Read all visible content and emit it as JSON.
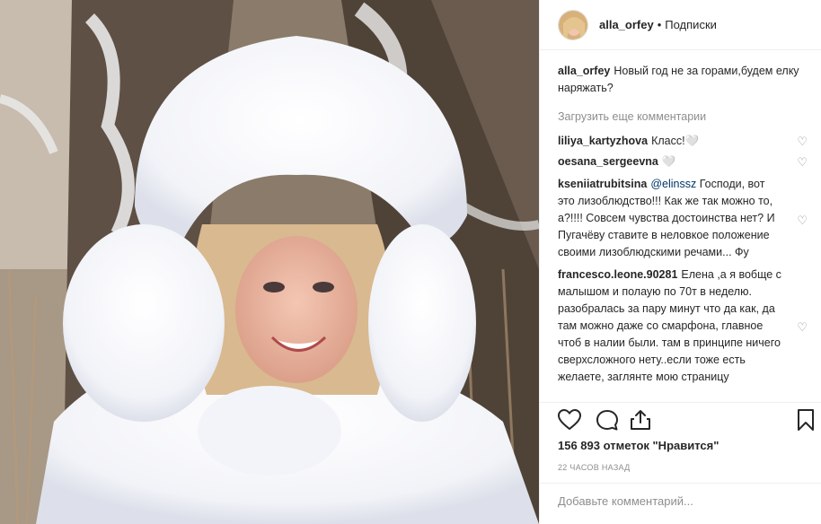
{
  "header": {
    "username": "alla_orfey",
    "separator": "•",
    "follow_label": "Подписки"
  },
  "caption": {
    "username": "alla_orfey",
    "text": "Новый год не за горами,будем елку наряжать?"
  },
  "load_more_label": "Загрузить еще комментарии",
  "comments": [
    {
      "username": "liliya_kartyzhova",
      "text": "Класс!🤍"
    },
    {
      "username": "oesana_sergeevna",
      "text": "🤍"
    },
    {
      "username": "kseniiatrubitsina",
      "mention": "@elinssz",
      "text": "Господи, вот это лизоблюдство!!! Как же так можно то, а?!!!! Совсем чувства достоинства нет? И Пугачёву ставите в неловкое положение своими лизоблюдскими речами... Фу"
    },
    {
      "username": "francesco.leone.90281",
      "text": "Елена ,а я вобще с малышом и полаую по 70т в неделю. разобралась за пару минут что да как, да там можно даже со смарфона, главное чтоб в налии были. там в принципе ничего сверхсложного нету..если тоже есть желаете, заглянте мою страницу"
    }
  ],
  "likes_text": "156 893 отметок \"Нравится\"",
  "timestamp": "22 ЧАСОВ НАЗАД",
  "add_comment_placeholder": "Добавьте комментарий...",
  "icons": [
    "heart-icon",
    "comment-icon",
    "share-icon",
    "bookmark-icon"
  ]
}
